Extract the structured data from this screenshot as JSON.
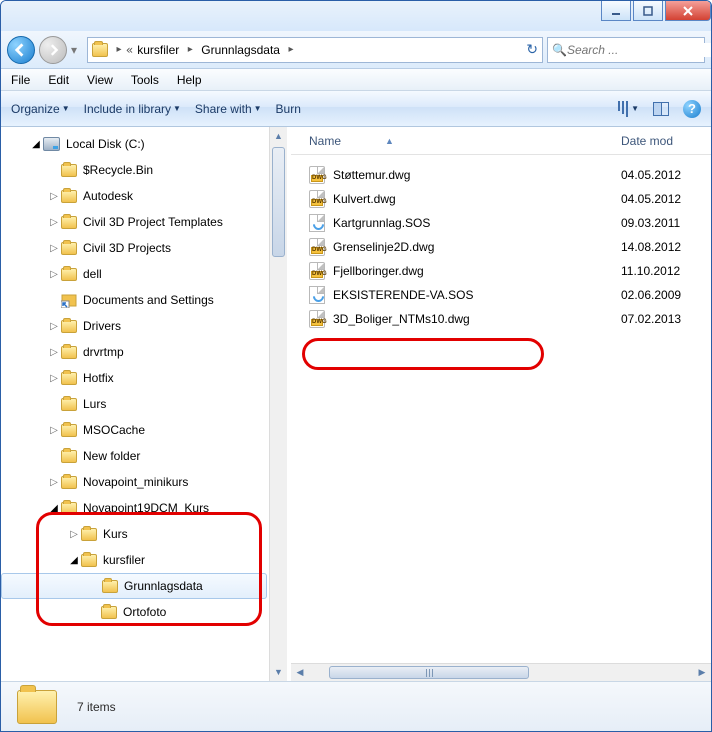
{
  "breadcrumb": {
    "seg1": "kursfiler",
    "seg2": "Grunnlagsdata"
  },
  "search": {
    "placeholder": "Search ..."
  },
  "menu": {
    "file": "File",
    "edit": "Edit",
    "view": "View",
    "tools": "Tools",
    "help": "Help"
  },
  "toolbar": {
    "organize": "Organize",
    "include": "Include in library",
    "share": "Share with",
    "burn": "Burn"
  },
  "tree_root": "Local Disk (C:)",
  "tree": [
    "$Recycle.Bin",
    "Autodesk",
    "Civil 3D Project Templates",
    "Civil 3D Projects",
    "dell",
    "Documents and Settings",
    "Drivers",
    "drvrtmp",
    "Hotfix",
    "Lurs",
    "MSOCache",
    "New folder",
    "Novapoint_minikurs",
    "Novapoint19DCM_Kurs",
    "Kurs",
    "kursfiler",
    "Grunnlagsdata",
    "Ortofoto"
  ],
  "hdr": {
    "name": "Name",
    "date": "Date mod"
  },
  "files": [
    {
      "name": "Støttemur.dwg",
      "date": "04.05.2012",
      "type": "dwg"
    },
    {
      "name": "Kulvert.dwg",
      "date": "04.05.2012",
      "type": "dwg"
    },
    {
      "name": "Kartgrunnlag.SOS",
      "date": "09.03.2011",
      "type": "sos"
    },
    {
      "name": "Grenselinje2D.dwg",
      "date": "14.08.2012",
      "type": "dwg"
    },
    {
      "name": "Fjellboringer.dwg",
      "date": "11.10.2012",
      "type": "dwg"
    },
    {
      "name": "EKSISTERENDE-VA.SOS",
      "date": "02.06.2009",
      "type": "sos"
    },
    {
      "name": "3D_Boliger_NTMs10.dwg",
      "date": "07.02.2013",
      "type": "dwg"
    }
  ],
  "status": {
    "count": "7 items"
  },
  "dwg_tag": "DWG"
}
